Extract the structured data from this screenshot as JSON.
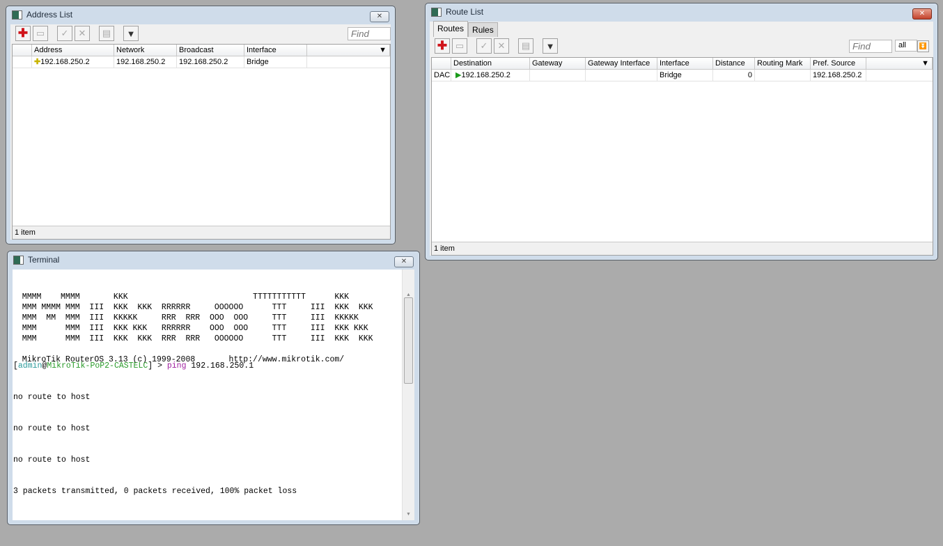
{
  "address_list": {
    "title": "Address List",
    "find_placeholder": "Find",
    "columns": [
      "Address",
      "Network",
      "Broadcast",
      "Interface"
    ],
    "rows": [
      {
        "address": "192.168.250.2",
        "network": "192.168.250.2",
        "broadcast": "192.168.250.2",
        "interface": "Bridge"
      }
    ],
    "status": "1 item"
  },
  "route_list": {
    "title": "Route List",
    "tabs": [
      "Routes",
      "Rules"
    ],
    "find_placeholder": "Find",
    "filter_value": "all",
    "columns": [
      "Destination",
      "Gateway",
      "Gateway Interface",
      "Interface",
      "Distance",
      "Routing Mark",
      "Pref. Source"
    ],
    "rows": [
      {
        "flags": "DAC",
        "destination": "192.168.250.2",
        "gateway": "",
        "gateway_interface": "",
        "interface": "Bridge",
        "distance": "0",
        "routing_mark": "",
        "pref_source": "192.168.250.2"
      }
    ],
    "status": "1 item"
  },
  "terminal": {
    "title": "Terminal",
    "banner": [
      "  MMMM    MMMM       KKK                          TTTTTTTTTTT      KKK",
      "  MMM MMMM MMM  III  KKK  KKK  RRRRRR     OOOOOO      TTT     III  KKK  KKK",
      "  MMM  MM  MMM  III  KKKKK     RRR  RRR  OOO  OOO     TTT     III  KKKKK",
      "  MMM      MMM  III  KKK KKK   RRRRRR    OOO  OOO     TTT     III  KKK KKK",
      "  MMM      MMM  III  KKK  KKK  RRR  RRR   OOOOOO      TTT     III  KKK  KKK",
      "",
      "  MikroTik RouterOS 3.13 (c) 1999-2008       http://www.mikrotik.com/"
    ],
    "prompt_user": "admin",
    "prompt_host": "MikroTik-PoP2-CASTELC",
    "prompt_command": "ping",
    "prompt_args": " 192.168.250.1",
    "output": [
      "no route to host",
      "no route to host",
      "no route to host",
      "3 packets transmitted, 0 packets received, 100% packet loss"
    ]
  }
}
